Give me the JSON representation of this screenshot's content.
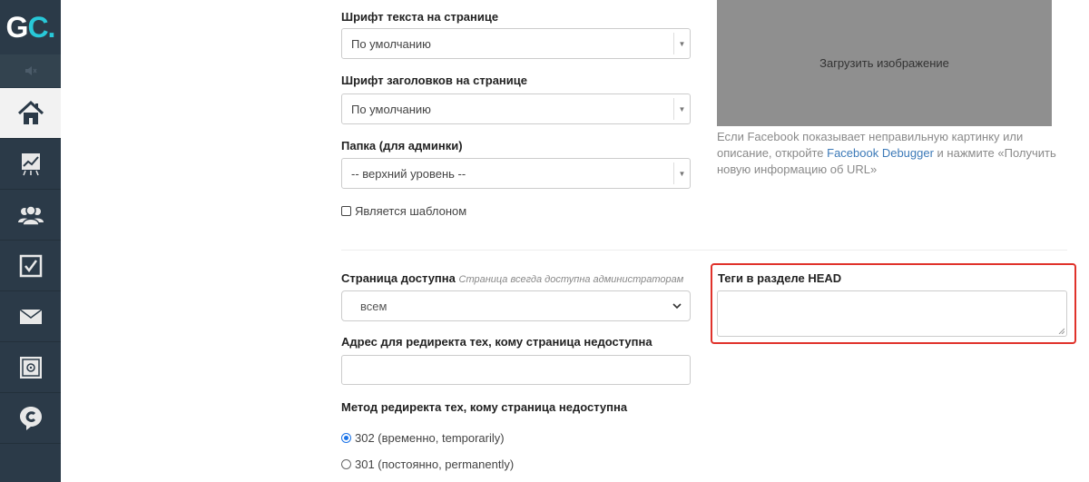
{
  "sidebar": {
    "logo": {
      "main": "G",
      "accent": "C."
    },
    "sound_icon": "speaker-muted-icon",
    "items": [
      {
        "name": "home",
        "icon": "home-icon",
        "active": true
      },
      {
        "name": "stats",
        "icon": "chart-icon"
      },
      {
        "name": "users",
        "icon": "users-icon"
      },
      {
        "name": "tasks",
        "icon": "checkbox-icon"
      },
      {
        "name": "mail",
        "icon": "envelope-icon"
      },
      {
        "name": "safe",
        "icon": "safe-icon"
      },
      {
        "name": "chat",
        "icon": "chat-bubble-icon"
      }
    ]
  },
  "form": {
    "text_font": {
      "label": "Шрифт текста на странице",
      "value": "По умолчанию"
    },
    "heading_font": {
      "label": "Шрифт заголовков на странице",
      "value": "По умолчанию"
    },
    "folder": {
      "label": "Папка (для админки)",
      "value": "-- верхний уровень --"
    },
    "is_template": {
      "label": "Является шаблоном",
      "checked": false
    },
    "availability": {
      "label": "Страница доступна",
      "hint": "Страница всегда доступна администраторам",
      "value": "всем"
    },
    "redirect_url": {
      "label": "Адрес для редиректа тех, кому страница недоступна",
      "value": ""
    },
    "redirect_method": {
      "label": "Метод редиректа тех, кому страница недоступна",
      "options": [
        {
          "label": "302 (временно, temporarily)",
          "selected": true
        },
        {
          "label": "301 (постоянно, permanently)",
          "selected": false
        }
      ]
    }
  },
  "image": {
    "upload_label": "Загрузить изображение",
    "note_before": "Если Facebook показывает неправильную картинку или описание, откройте ",
    "note_link": "Facebook Debugger",
    "note_after": " и нажмите «Получить новую информацию об URL»"
  },
  "head_tags": {
    "label": "Теги в разделе HEAD",
    "value": ""
  },
  "colors": {
    "sidebar": "#2b3a48",
    "accent": "#28c8d8",
    "highlight": "#e0322b",
    "link": "#3d7ab8"
  }
}
